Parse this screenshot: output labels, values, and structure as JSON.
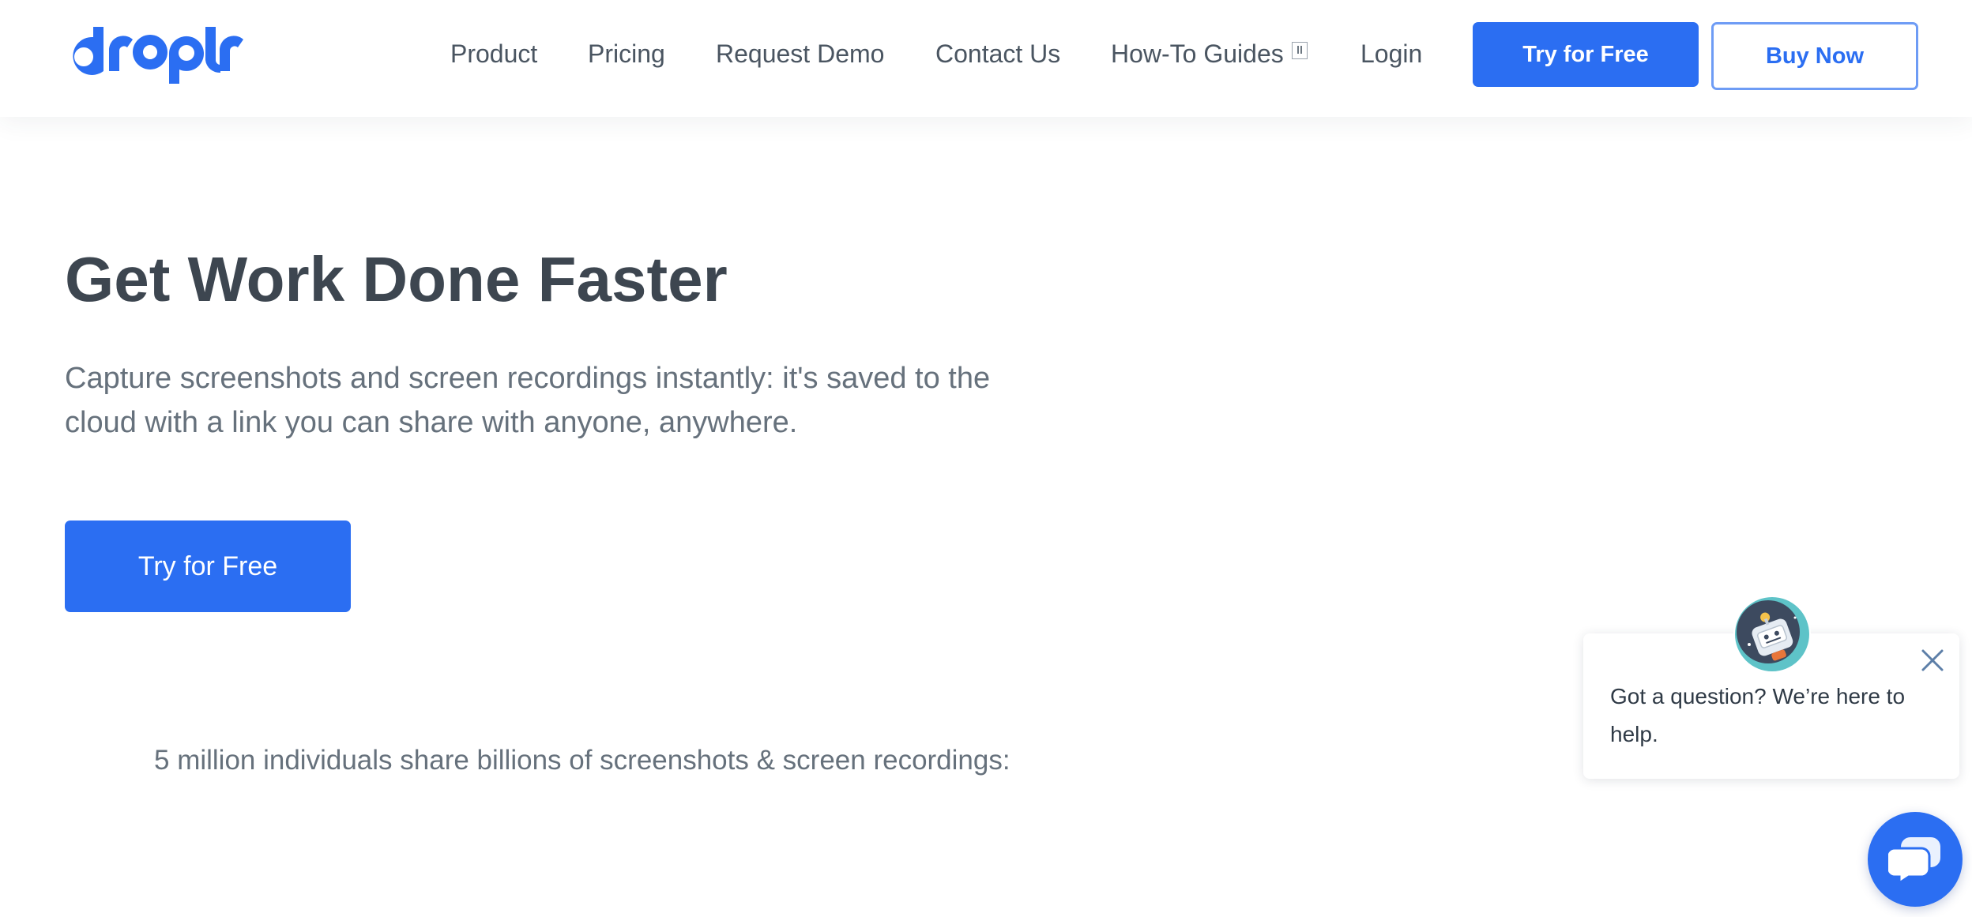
{
  "brand": {
    "logo_text": "droplr",
    "accent_color": "#2b6ef2"
  },
  "nav": {
    "items": [
      {
        "label": "Product"
      },
      {
        "label": "Pricing"
      },
      {
        "label": "Request Demo"
      },
      {
        "label": "Contact Us"
      },
      {
        "label": "How-To Guides",
        "icon": "external-link-icon"
      },
      {
        "label": "Login"
      }
    ],
    "try_label": "Try for Free",
    "buy_label": "Buy Now"
  },
  "hero": {
    "title": "Get Work Done Faster",
    "subtitle": "Capture screenshots and screen recordings instantly: it's saved to the cloud with a link you can share with anyone, anywhere.",
    "cta_label": "Try for Free",
    "stat_text": "5 million individuals share billions of screenshots & screen recordings:"
  },
  "chat": {
    "message": "Got a question? We’re here to help.",
    "avatar_icon": "robot-avatar-icon",
    "close_icon": "close-icon",
    "launcher_icon": "chat-bubble-icon"
  }
}
